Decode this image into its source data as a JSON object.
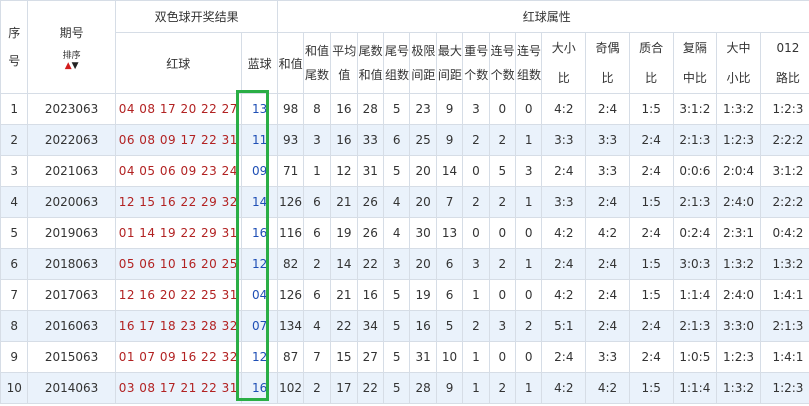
{
  "header": {
    "seq": "序号",
    "period": "期号",
    "sort_label": "排序",
    "draw_group": "双色球开奖结果",
    "red_ball": "红球",
    "blue_ball": "蓝球",
    "attr_group": "红球属性",
    "sum": "和值",
    "tail_sum": "和值 尾数",
    "avg": "平均 值",
    "tail_sum2": "尾数 和值",
    "tail_groups": "尾号 组数",
    "range": "极限 间距",
    "max_gap": "最大 间距",
    "repeat": "重号 个数",
    "consec_cnt": "连号 个数",
    "consec_grp": "连号 组数",
    "size_ratio": "大小 比",
    "odd_even": "奇偶 比",
    "prime_comp": "质合 比",
    "repeat_mid": "复隔 中比",
    "big_mid_small": "大中 小比",
    "road012": "012 路比"
  },
  "rows": [
    {
      "seq": "1",
      "period": "2023063",
      "red": "04 08 17 20 22 27",
      "blue": "13",
      "sum": "98",
      "ts": "8",
      "avg": "16",
      "ts2": "28",
      "tg": "5",
      "rg": "23",
      "mg": "9",
      "rp": "3",
      "cc": "0",
      "cg": "0",
      "sz": "4:2",
      "oe": "2:4",
      "pc": "1:5",
      "rm": "3:1:2",
      "bms": "1:3:2",
      "r012": "1:2:3"
    },
    {
      "seq": "2",
      "period": "2022063",
      "red": "06 08 09 17 22 31",
      "blue": "11",
      "sum": "93",
      "ts": "3",
      "avg": "16",
      "ts2": "33",
      "tg": "6",
      "rg": "25",
      "mg": "9",
      "rp": "2",
      "cc": "2",
      "cg": "1",
      "sz": "3:3",
      "oe": "3:3",
      "pc": "2:4",
      "rm": "2:1:3",
      "bms": "1:2:3",
      "r012": "2:2:2"
    },
    {
      "seq": "3",
      "period": "2021063",
      "red": "04 05 06 09 23 24",
      "blue": "09",
      "sum": "71",
      "ts": "1",
      "avg": "12",
      "ts2": "31",
      "tg": "5",
      "rg": "20",
      "mg": "14",
      "rp": "0",
      "cc": "5",
      "cg": "3",
      "sz": "2:4",
      "oe": "3:3",
      "pc": "2:4",
      "rm": "0:0:6",
      "bms": "2:0:4",
      "r012": "3:1:2"
    },
    {
      "seq": "4",
      "period": "2020063",
      "red": "12 15 16 22 29 32",
      "blue": "14",
      "sum": "126",
      "ts": "6",
      "avg": "21",
      "ts2": "26",
      "tg": "4",
      "rg": "20",
      "mg": "7",
      "rp": "2",
      "cc": "2",
      "cg": "1",
      "sz": "3:3",
      "oe": "2:4",
      "pc": "1:5",
      "rm": "2:1:3",
      "bms": "2:4:0",
      "r012": "2:2:2"
    },
    {
      "seq": "5",
      "period": "2019063",
      "red": "01 14 19 22 29 31",
      "blue": "16",
      "sum": "116",
      "ts": "6",
      "avg": "19",
      "ts2": "26",
      "tg": "4",
      "rg": "30",
      "mg": "13",
      "rp": "0",
      "cc": "0",
      "cg": "0",
      "sz": "4:2",
      "oe": "4:2",
      "pc": "2:4",
      "rm": "0:2:4",
      "bms": "2:3:1",
      "r012": "0:4:2"
    },
    {
      "seq": "6",
      "period": "2018063",
      "red": "05 06 10 16 20 25",
      "blue": "12",
      "sum": "82",
      "ts": "2",
      "avg": "14",
      "ts2": "22",
      "tg": "3",
      "rg": "20",
      "mg": "6",
      "rp": "3",
      "cc": "2",
      "cg": "1",
      "sz": "2:4",
      "oe": "2:4",
      "pc": "1:5",
      "rm": "3:0:3",
      "bms": "1:3:2",
      "r012": "1:3:2"
    },
    {
      "seq": "7",
      "period": "2017063",
      "red": "12 16 20 22 25 31",
      "blue": "04",
      "sum": "126",
      "ts": "6",
      "avg": "21",
      "ts2": "16",
      "tg": "5",
      "rg": "19",
      "mg": "6",
      "rp": "1",
      "cc": "0",
      "cg": "0",
      "sz": "4:2",
      "oe": "2:4",
      "pc": "1:5",
      "rm": "1:1:4",
      "bms": "2:4:0",
      "r012": "1:4:1"
    },
    {
      "seq": "8",
      "period": "2016063",
      "red": "16 17 18 23 28 32",
      "blue": "07",
      "sum": "134",
      "ts": "4",
      "avg": "22",
      "ts2": "34",
      "tg": "5",
      "rg": "16",
      "mg": "5",
      "rp": "2",
      "cc": "3",
      "cg": "2",
      "sz": "5:1",
      "oe": "2:4",
      "pc": "2:4",
      "rm": "2:1:3",
      "bms": "3:3:0",
      "r012": "2:1:3"
    },
    {
      "seq": "9",
      "period": "2015063",
      "red": "01 07 09 16 22 32",
      "blue": "12",
      "sum": "87",
      "ts": "7",
      "avg": "15",
      "ts2": "27",
      "tg": "5",
      "rg": "31",
      "mg": "10",
      "rp": "1",
      "cc": "0",
      "cg": "0",
      "sz": "2:4",
      "oe": "3:3",
      "pc": "2:4",
      "rm": "1:0:5",
      "bms": "1:2:3",
      "r012": "1:4:1"
    },
    {
      "seq": "10",
      "period": "2014063",
      "red": "03 08 17 21 22 31",
      "blue": "16",
      "sum": "102",
      "ts": "2",
      "avg": "17",
      "ts2": "22",
      "tg": "5",
      "rg": "28",
      "mg": "9",
      "rp": "1",
      "cc": "2",
      "cg": "1",
      "sz": "4:2",
      "oe": "4:2",
      "pc": "1:5",
      "rm": "1:1:4",
      "bms": "1:3:2",
      "r012": "1:2:3"
    }
  ],
  "colors": {
    "highlight": "#2aae45",
    "red_text": "#b22222",
    "blue_text": "#1f4fb5",
    "stripe": "#eaf2fb"
  }
}
